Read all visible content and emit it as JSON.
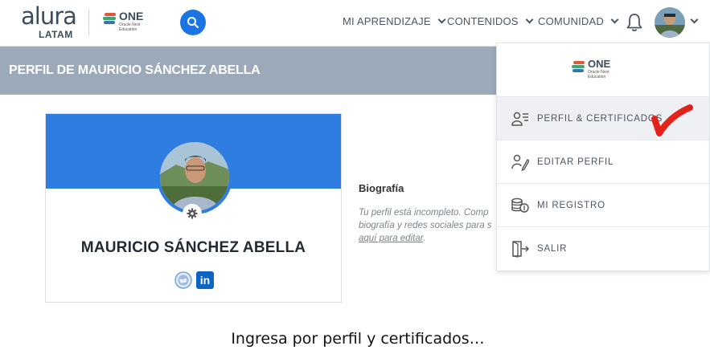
{
  "header": {
    "logo_word": "alura",
    "logo_sub": "LATAM",
    "one_logo": "ONE",
    "one_logo_sub": "Oracle Next Education",
    "nav": [
      {
        "label": "MI APRENDIZAJE"
      },
      {
        "label": "CONTENIDOS"
      },
      {
        "label": "COMUNIDAD"
      }
    ]
  },
  "banner": {
    "title": "PERFIL DE MAURICIO SÁNCHEZ ABELLA"
  },
  "profile": {
    "name": "MAURICIO SÁNCHEZ ABELLA",
    "bio_title": "Biografía",
    "bio_line1": "Tu perfil está incompleto. Comp",
    "bio_line2": "biografía y redes sociales para s",
    "bio_link": "aquí para editar",
    "bio_tail": ".",
    "linkedin": "in"
  },
  "dropdown": {
    "logo": "ONE",
    "logo_sub": "Oracle Next Education",
    "items": [
      {
        "label": "PERFIL & CERTIFICADOS"
      },
      {
        "label": "EDITAR PERFIL"
      },
      {
        "label": "MI REGISTRO"
      },
      {
        "label": "SALIR"
      }
    ]
  },
  "caption": "Ingresa por perfil y certificados…",
  "colors": {
    "accent": "#1b74e4",
    "card_banner": "#2f7de1",
    "page_banner": "#9ba9b9",
    "check": "#e2231a"
  }
}
